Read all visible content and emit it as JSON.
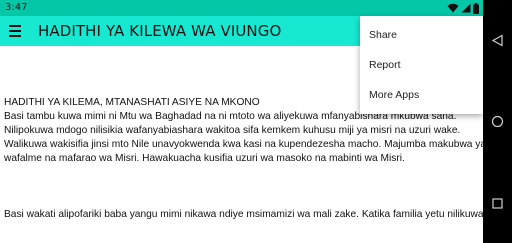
{
  "status_bar": {
    "time": "3:47",
    "icons": [
      "wifi-icon",
      "signal-icon",
      "battery-icon"
    ]
  },
  "app_bar": {
    "title": "HADITHI YA KILEWA WA VIUNGO",
    "background": "#17e8d2"
  },
  "overflow_menu": {
    "items": [
      {
        "label": "Share"
      },
      {
        "label": "Report"
      },
      {
        "label": "More Apps"
      }
    ]
  },
  "content": {
    "lines_block1": [
      "HADITHI YA KILEMA, MTANASHATI ASIYE NA MKONO",
      "Basi tambu kuwa mimi ni Mtu wa Baghadad na ni mtoto wa aliyekuwa mfanyabishara mkubwa sana.",
      "Nilipokuwa mdogo nilisikia wafanyabiashara wakitoa sifa kemkem kuhusu miji ya misri na uzuri wake.",
      "Walikuwa wakisifia jinsi mto Nile unavyokwenda kwa kasi na kupendezesha macho. Majumba makubwa ya",
      "wafalme na mafarao wa Misri. Hawakuacha kusifia uzuri wa masoko na mabinti wa Misri."
    ],
    "lines_block2": [
      "Basi wakati alipofariki baba yangu mimi nikawa ndiye msimamizi wa mali zake. Katika familia yetu nilikuwa"
    ]
  },
  "nav_bar": {
    "buttons": [
      "back-icon",
      "home-icon",
      "recents-icon"
    ]
  }
}
